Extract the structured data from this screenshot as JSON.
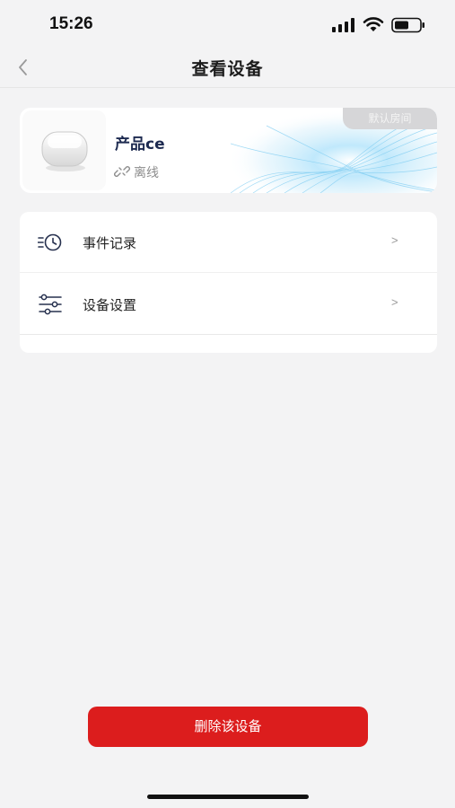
{
  "status_bar": {
    "time": "15:26",
    "icons": [
      "signal-icon",
      "wifi-icon",
      "battery-icon"
    ]
  },
  "nav": {
    "title": "查看设备",
    "back_icon": "chevron-left-icon"
  },
  "device": {
    "name": "产品ce",
    "status": "离线",
    "status_icon": "unlink-icon",
    "room": "默认房间",
    "accent_color": "#1d2a50"
  },
  "menu": {
    "items": [
      {
        "label": "事件记录",
        "icon": "history-clock-icon",
        "arrow": ">"
      },
      {
        "label": "设备设置",
        "icon": "settings-sliders-icon",
        "arrow": ">"
      }
    ]
  },
  "actions": {
    "delete_label": "删除该设备",
    "delete_color": "#dc1d1d"
  }
}
